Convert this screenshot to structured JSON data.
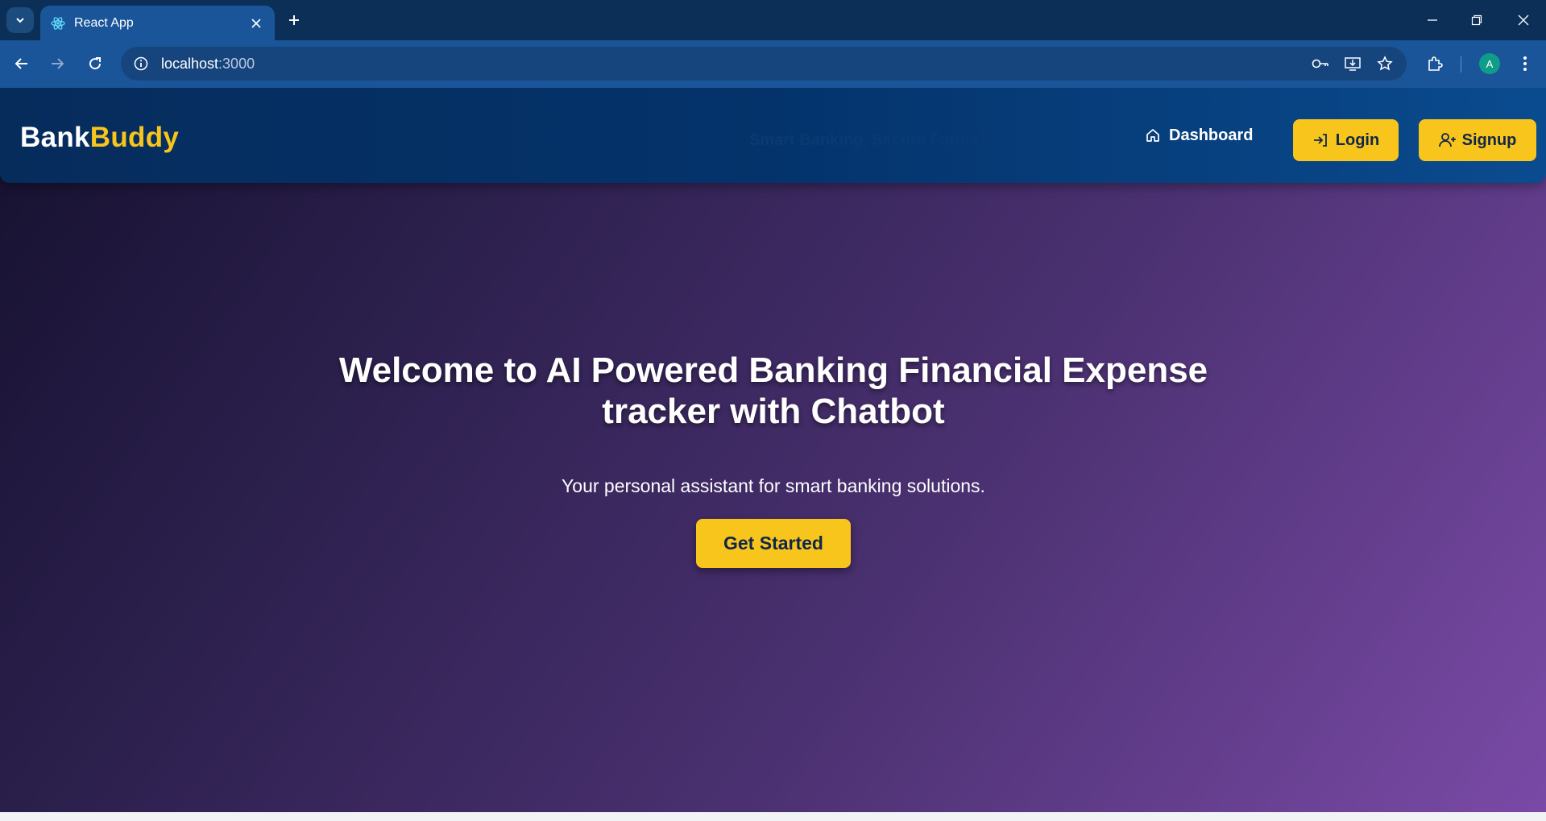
{
  "browser": {
    "tab_title": "React App",
    "url_host": "localhost",
    "url_port": ":3000",
    "profile_initial": "A"
  },
  "navbar": {
    "brand_part1": "Bank",
    "brand_part2": "Buddy",
    "tagline": "Smart Banking, Secure Future!",
    "dashboard_label": "Dashboard",
    "login_label": "Login",
    "signup_label": "Signup"
  },
  "hero": {
    "title_line1": "Welcome to AI Powered Banking Financial Expense",
    "title_line2": "tracker with Chatbot",
    "subtitle": "Your personal assistant for smart banking solutions.",
    "cta_label": "Get Started"
  },
  "colors": {
    "accent_yellow": "#f8c51c",
    "navbar_blue": "#04336b",
    "gradient_start": "#15112f",
    "gradient_end": "#7a4aa6"
  }
}
